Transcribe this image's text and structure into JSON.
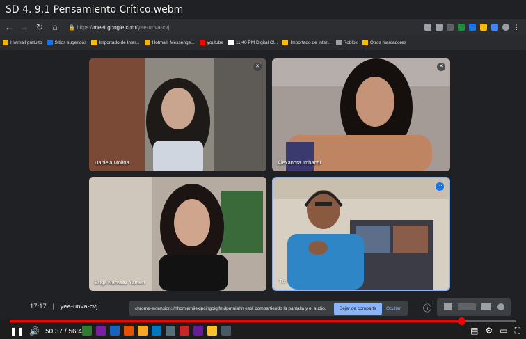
{
  "video": {
    "title": "SD 4. 9.1 Pensamiento Crítico.webm",
    "current_time": "50:37",
    "duration": "56:49",
    "progress_fraction": 0.891
  },
  "browser": {
    "url_prefix": "https://",
    "url_host": "meet.google.com",
    "url_path": "/yee-unva-cvj",
    "bookmarks": [
      {
        "label": "Hotmail gratuito",
        "color": "#f4b400"
      },
      {
        "label": "Sitios sugeridos",
        "color": "#1a73e8"
      },
      {
        "label": "Importado de Inter...",
        "color": "#fbbc04"
      },
      {
        "label": "Hotmail, Messenge...",
        "color": "#f4b400"
      },
      {
        "label": "youtube",
        "color": "#ff0000"
      },
      {
        "label": "11:40 PM Digital Cl...",
        "color": "#ffffff"
      },
      {
        "label": "Importado de Inter...",
        "color": "#fbbc04"
      },
      {
        "label": "Roblox",
        "color": "#9e9e9e"
      },
      {
        "label": "Otros marcadores",
        "color": "#fbbc04"
      }
    ]
  },
  "meet": {
    "participants": [
      {
        "name": "Daniela Molina"
      },
      {
        "name": "Alexandra Imbachi"
      },
      {
        "name": "Brigit Narvaez Yamen"
      },
      {
        "name": "Tú"
      }
    ],
    "meeting_time": "17:17",
    "meeting_code": "yee-unva-cvj",
    "share_message": "chrome-extension://hhcmiemiiexjpcingoigjfmdprnniahn está compartiendo la pantalla y el audio.",
    "stop_share_label": "Dejar de compartir",
    "hide_label": "Ocultar"
  },
  "colors": {
    "accent": "#8ab4f8",
    "progress": "#ff0000"
  }
}
